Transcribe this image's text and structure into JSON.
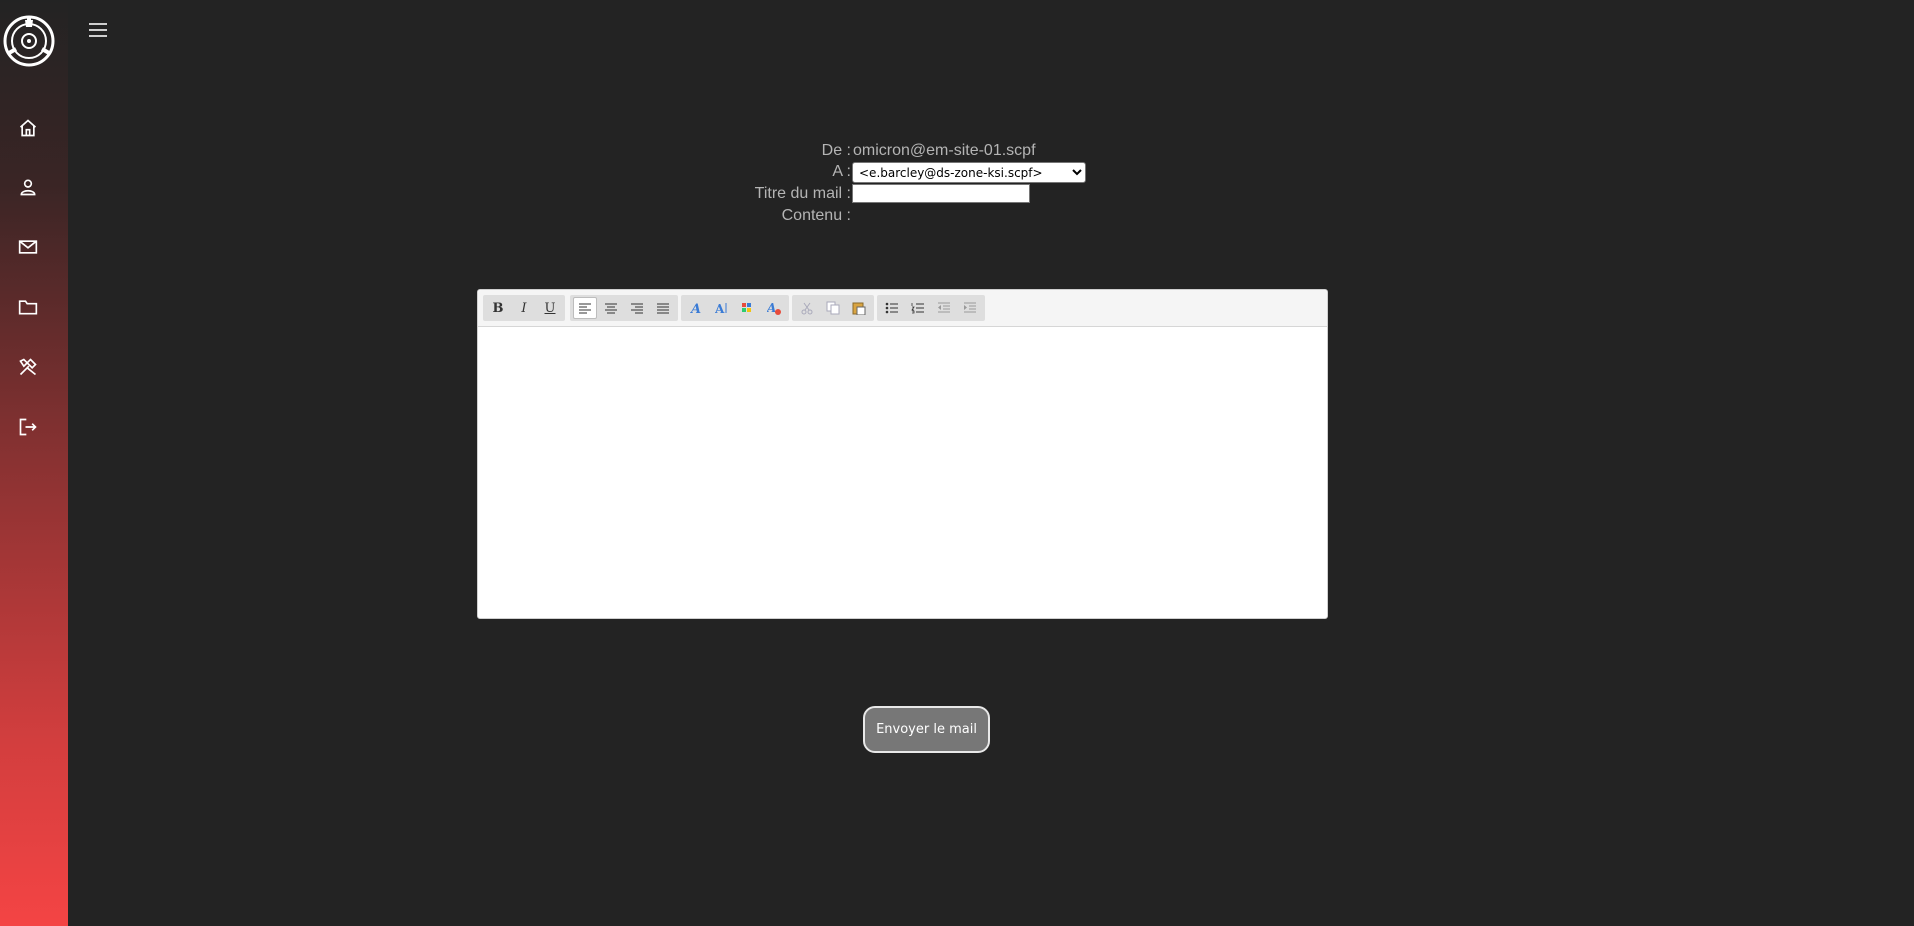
{
  "sidebar": {
    "logo": "scp-foundation-logo",
    "items": [
      {
        "name": "home",
        "icon": "home-icon"
      },
      {
        "name": "profile",
        "icon": "user-icon"
      },
      {
        "name": "mail",
        "icon": "mail-icon"
      },
      {
        "name": "files",
        "icon": "folder-icon"
      },
      {
        "name": "tools",
        "icon": "tools-icon"
      },
      {
        "name": "logout",
        "icon": "logout-icon"
      }
    ]
  },
  "header": {
    "menu_icon": "hamburger-icon"
  },
  "form": {
    "from_label": "De :",
    "from_value": "omicron@em-site-01.scpf",
    "to_label": "A :",
    "to_selected": "<e.barcley@ds-zone-ksi.scpf>",
    "subject_label": "Titre du mail :",
    "subject_value": "",
    "content_label": "Contenu :"
  },
  "editor": {
    "toolbar_groups": [
      [
        "bold",
        "italic",
        "underline"
      ],
      [
        "align-left",
        "align-center",
        "align-right",
        "justify"
      ],
      [
        "font-family",
        "font-size",
        "text-color",
        "remove-format"
      ],
      [
        "cut",
        "copy",
        "paste"
      ],
      [
        "bullet-list",
        "numbered-list",
        "outdent",
        "indent"
      ]
    ],
    "bold_label": "B",
    "italic_label": "I",
    "underline_label": "U",
    "content": ""
  },
  "send_button": "Envoyer le mail",
  "colors": {
    "background": "#232323",
    "sidebar_bottom": "#f44444",
    "button": "#777777"
  }
}
